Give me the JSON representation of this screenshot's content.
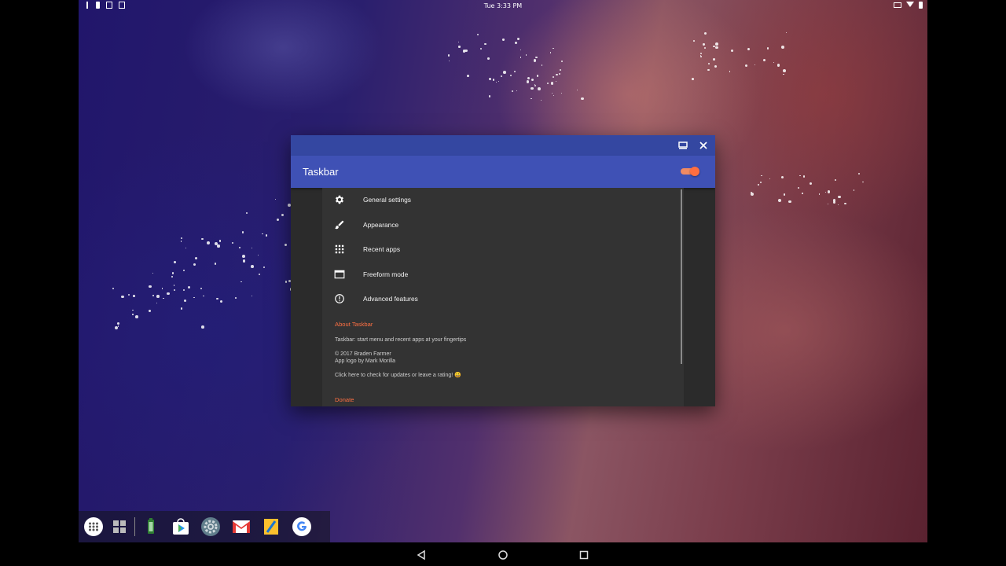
{
  "status_bar": {
    "time": "Tue 3:33 PM"
  },
  "window": {
    "app_title": "Taskbar",
    "enabled": true,
    "menu_items": [
      {
        "label": "General settings",
        "icon": "gear-icon"
      },
      {
        "label": "Appearance",
        "icon": "brush-icon"
      },
      {
        "label": "Recent apps",
        "icon": "grid-icon"
      },
      {
        "label": "Freeform mode",
        "icon": "window-icon"
      },
      {
        "label": "Advanced features",
        "icon": "alert-circle-icon"
      }
    ],
    "about": {
      "section_title": "About Taskbar",
      "description": "Taskbar: start menu and recent apps at your fingertips",
      "copyright": "© 2017 Braden Farmer",
      "logo_credit": "App logo by Mark Morilla",
      "rate_prompt": "Click here to check for updates or leave a rating! 😀"
    },
    "donate": {
      "section_title": "Donate"
    }
  },
  "taskbar_apps": [
    "app-drawer-icon",
    "recent-apps-grid-icon",
    "battery-app-icon",
    "play-store-icon",
    "settings-icon",
    "gmail-icon",
    "files-app-icon",
    "google-icon"
  ],
  "colors": {
    "title_bar": "#3447a1",
    "app_bar": "#3f51b5",
    "accent": "#ff7043",
    "content_bg": "#333333"
  }
}
